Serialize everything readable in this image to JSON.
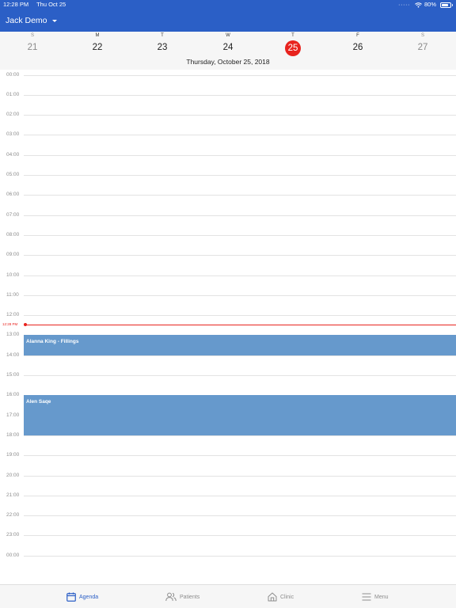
{
  "colors": {
    "header_bg": "#2b5fc6",
    "accent": "#2b5fc6",
    "today": "#e8231e",
    "event_bg": "#6699cc"
  },
  "status_bar": {
    "time": "12:28 PM",
    "date": "Thu Oct 25",
    "battery": "80%",
    "battery_level": 0.8
  },
  "header": {
    "user_name": "Jack Demo"
  },
  "week": {
    "days": [
      {
        "letter": "S",
        "number": "21",
        "weekend": true,
        "selected": false
      },
      {
        "letter": "M",
        "number": "22",
        "weekend": false,
        "selected": false
      },
      {
        "letter": "T",
        "number": "23",
        "weekend": false,
        "selected": false
      },
      {
        "letter": "W",
        "number": "24",
        "weekend": false,
        "selected": false
      },
      {
        "letter": "T",
        "number": "25",
        "weekend": false,
        "selected": true
      },
      {
        "letter": "F",
        "number": "26",
        "weekend": false,
        "selected": false
      },
      {
        "letter": "S",
        "number": "27",
        "weekend": true,
        "selected": false
      }
    ],
    "selected_date_label": "Thursday, October 25, 2018"
  },
  "agenda": {
    "hours": [
      "00:00",
      "01:00",
      "02:00",
      "03:00",
      "04:00",
      "05:00",
      "06:00",
      "07:00",
      "08:00",
      "09:00",
      "10:00",
      "11:00",
      "12:00",
      "13:00",
      "14:00",
      "15:00",
      "16:00",
      "17:00",
      "18:00",
      "19:00",
      "20:00",
      "21:00",
      "22:00",
      "23:00",
      "00:00"
    ],
    "now_label": "12:28 PM",
    "now_hour": 12.47,
    "events": [
      {
        "title": "Alanna King - Fillings",
        "start_hour": 13.0,
        "end_hour": 14.0
      },
      {
        "title": "Alen Saqe",
        "start_hour": 16.0,
        "end_hour": 18.0
      }
    ]
  },
  "tabs": [
    {
      "label": "Agenda",
      "icon": "calendar-icon",
      "active": true
    },
    {
      "label": "Patients",
      "icon": "users-icon",
      "active": false
    },
    {
      "label": "Clinic",
      "icon": "home-icon",
      "active": false
    },
    {
      "label": "Menu",
      "icon": "menu-icon",
      "active": false
    }
  ]
}
